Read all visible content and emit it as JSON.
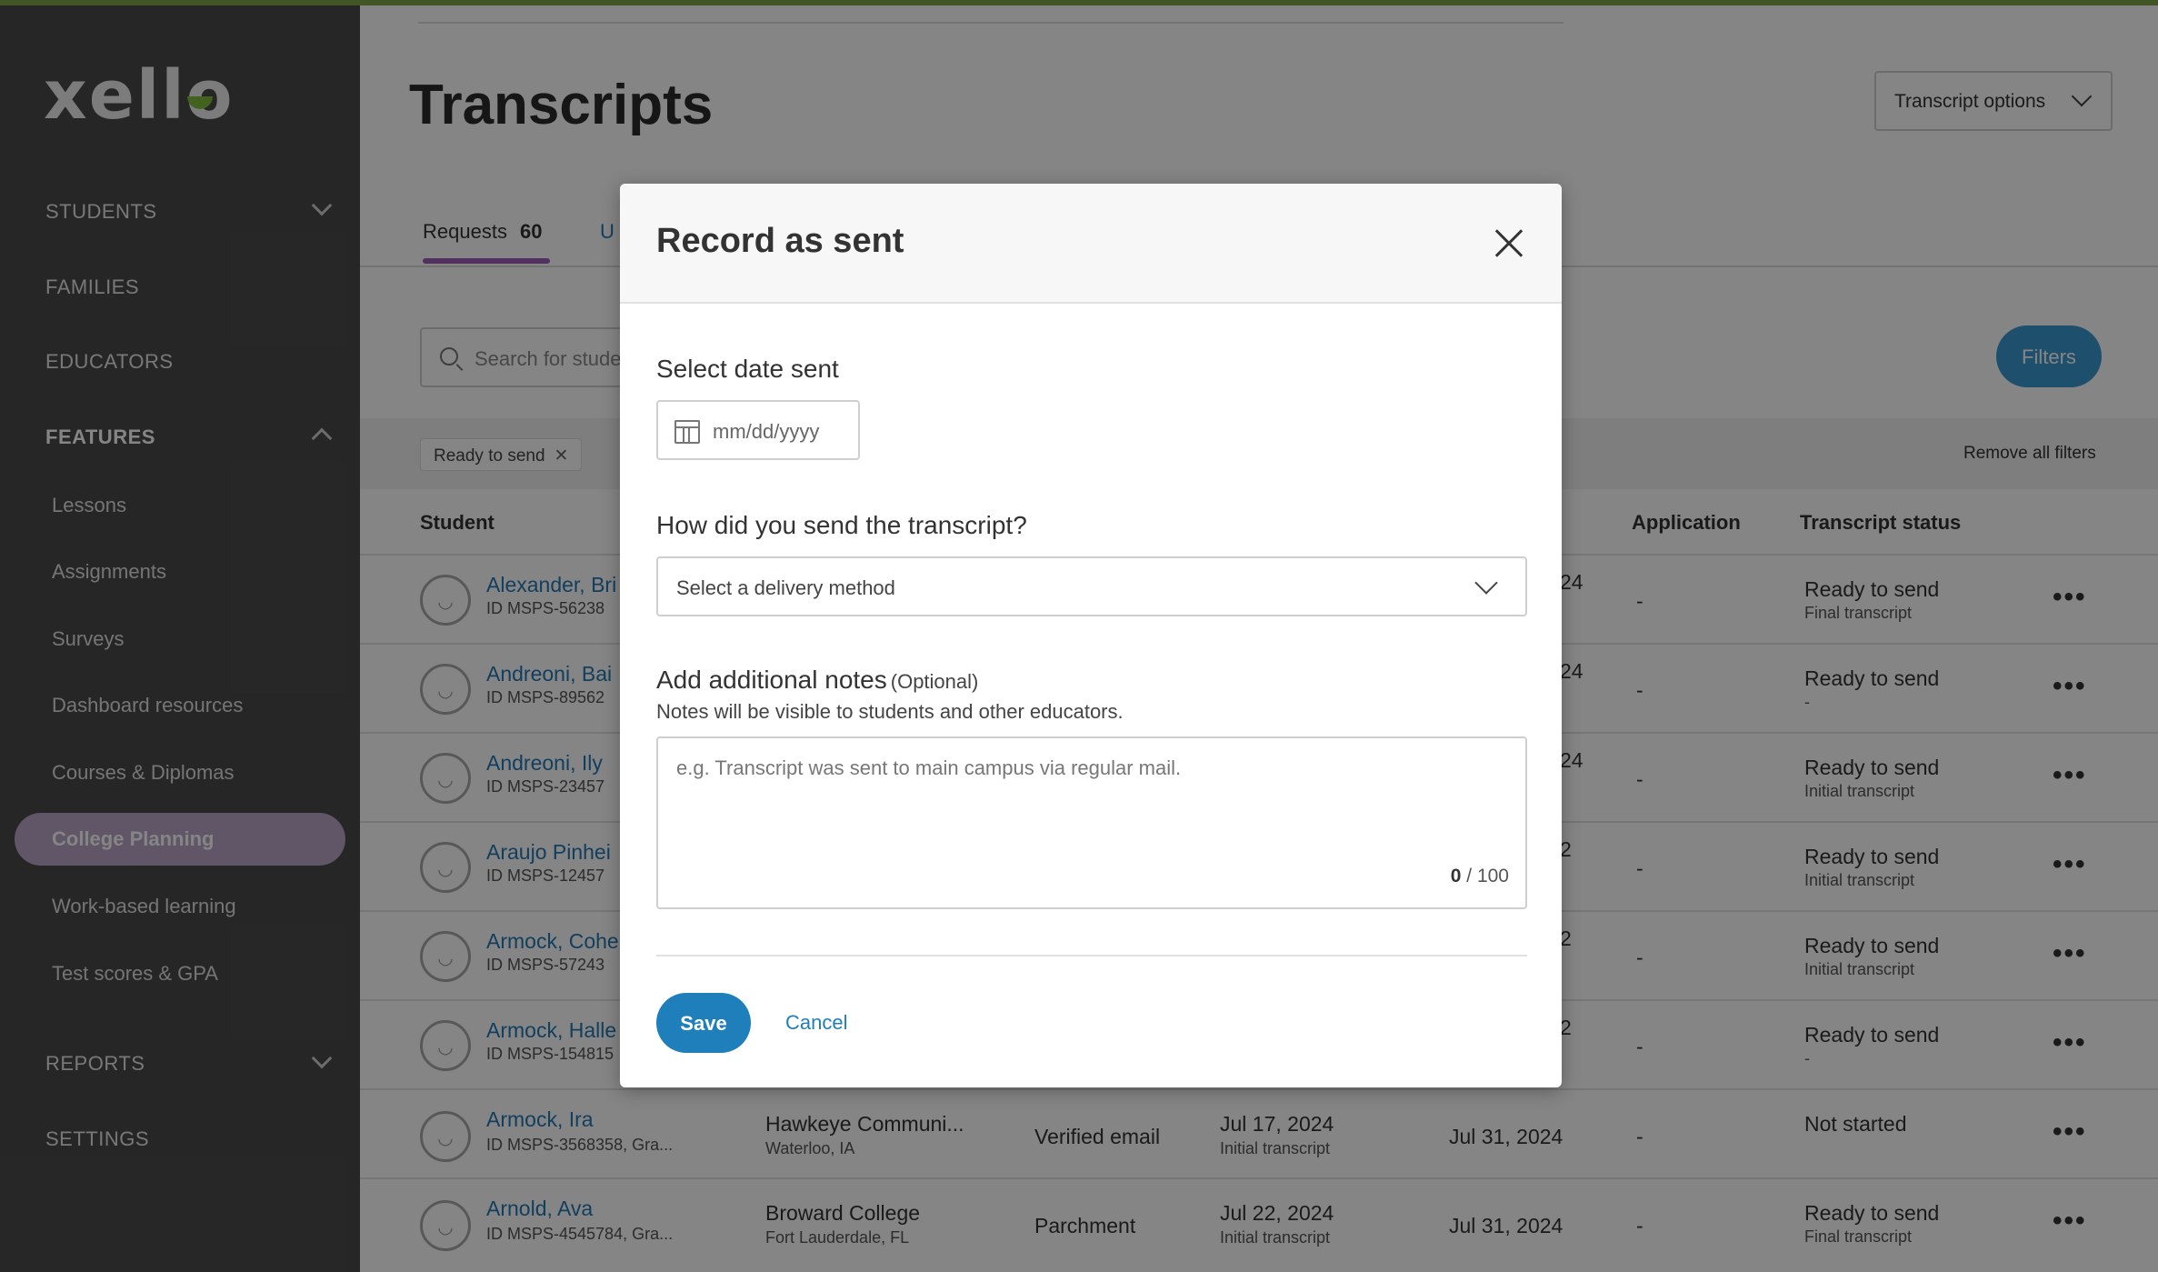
{
  "app": {
    "logo": "xello"
  },
  "sidebar": {
    "sections": [
      {
        "label": "STUDENTS"
      },
      {
        "label": "FAMILIES"
      },
      {
        "label": "EDUCATORS"
      },
      {
        "label": "FEATURES"
      },
      {
        "label": "REPORTS"
      },
      {
        "label": "SETTINGS"
      }
    ],
    "features": [
      {
        "label": "Lessons"
      },
      {
        "label": "Assignments"
      },
      {
        "label": "Surveys"
      },
      {
        "label": "Dashboard resources"
      },
      {
        "label": "Courses & Diplomas"
      },
      {
        "label": "College Planning"
      },
      {
        "label": "Work-based learning"
      },
      {
        "label": "Test scores & GPA"
      }
    ]
  },
  "page": {
    "title": "Transcripts",
    "options_label": "Transcript options",
    "tabs": [
      {
        "label": "Requests",
        "count": "60"
      },
      {
        "label": "U"
      }
    ],
    "search_placeholder": "Search for stude",
    "filters_label": "Filters",
    "active_filter": "Ready to send",
    "filter_close": "✕",
    "remove_all": "Remove all filters"
  },
  "table": {
    "headers": {
      "student": "Student",
      "application": "Application",
      "status": "Transcript status"
    },
    "rows": [
      {
        "name": "Alexander, Bri",
        "id": "ID MSPS-56238",
        "frag": "24",
        "application": "-",
        "status": "Ready to send",
        "status_sub": "Final transcript"
      },
      {
        "name": "Andreoni, Bai",
        "id": "ID MSPS-89562",
        "frag": "24",
        "application": "-",
        "status": "Ready to send",
        "status_sub": "-"
      },
      {
        "name": "Andreoni, Ily",
        "id": "ID MSPS-23457",
        "frag": "24",
        "application": "-",
        "status": "Ready to send",
        "status_sub": "Initial transcript"
      },
      {
        "name": "Araujo Pinhei",
        "id": "ID MSPS-12457",
        "frag": "2",
        "application": "-",
        "status": "Ready to send",
        "status_sub": "Initial transcript"
      },
      {
        "name": "Armock, Cohe",
        "id": "ID MSPS-57243",
        "frag": "2",
        "application": "-",
        "status": "Ready to send",
        "status_sub": "Initial transcript"
      },
      {
        "name": "Armock, Halle",
        "id": "ID MSPS-154815",
        "frag": "2",
        "application": "-",
        "status": "Ready to send",
        "status_sub": "-"
      },
      {
        "name": "Armock, Ira",
        "id": "ID MSPS-3568358, Gra...",
        "school": "Hawkeye Communi...",
        "location": "Waterloo, IA",
        "method": "Verified email",
        "requested": "Jul 17, 2024",
        "requested_sub": "Initial transcript",
        "deadline": "Jul 31, 2024",
        "application": "-",
        "status": "Not started",
        "status_sub": ""
      },
      {
        "name": "Arnold, Ava",
        "id": "ID MSPS-4545784, Gra...",
        "school": "Broward College",
        "location": "Fort Lauderdale, FL",
        "method": "Parchment",
        "requested": "Jul 22, 2024",
        "requested_sub": "Initial transcript",
        "deadline": "Jul 31, 2024",
        "application": "-",
        "status": "Ready to send",
        "status_sub": "Final transcript"
      }
    ],
    "row_menu": "•••"
  },
  "modal": {
    "title": "Record as sent",
    "date_label": "Select date sent",
    "date_placeholder": "mm/dd/yyyy",
    "method_label": "How did you send the transcript?",
    "method_placeholder": "Select a delivery method",
    "notes_label": "Add additional notes",
    "notes_optional": "(Optional)",
    "notes_hint": "Notes will be visible to students and other educators.",
    "notes_placeholder": "e.g. Transcript was sent to main campus via regular mail.",
    "counter_current": "0",
    "counter_max": "/ 100",
    "save_label": "Save",
    "cancel_label": "Cancel"
  },
  "colors": {
    "sidebar_bg": "#4a4a4a",
    "accent_purple": "#9b5fb5",
    "primary_blue": "#1f7fbb",
    "link_blue": "#2379b5",
    "brand_green": "#7fbf3c"
  }
}
